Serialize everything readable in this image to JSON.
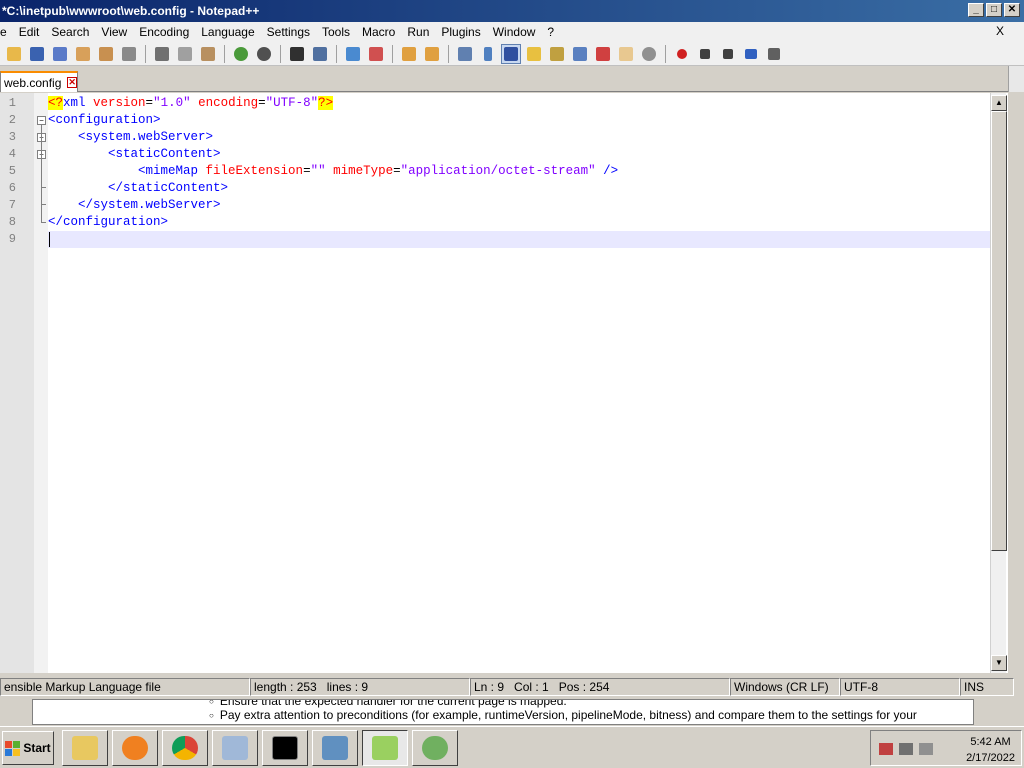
{
  "window": {
    "title": "*C:\\inetpub\\wwwroot\\web.config - Notepad++",
    "minimize": "_",
    "maximize": "□",
    "close": "✕"
  },
  "menu": {
    "items": [
      "e",
      "Edit",
      "Search",
      "View",
      "Encoding",
      "Language",
      "Settings",
      "Tools",
      "Macro",
      "Run",
      "Plugins",
      "Window",
      "?"
    ],
    "close_doc": "X"
  },
  "toolbar": {
    "icons": [
      "open-icon",
      "save-icon",
      "save-all-icon",
      "close-icon",
      "close-all-icon",
      "print-icon",
      "cut-icon",
      "copy-icon",
      "paste-icon",
      "undo-icon",
      "redo-icon",
      "find-icon",
      "replace-icon",
      "zoom-in-icon",
      "zoom-out-icon",
      "sync-v-icon",
      "sync-h-icon",
      "word-wrap-icon",
      "show-all-chars-icon",
      "indent-guide-icon",
      "udl-icon",
      "doc-map-icon",
      "function-list-icon",
      "folder-workspace-icon",
      "monitoring-icon",
      "record-macro-icon",
      "stop-macro-icon",
      "play-macro-icon",
      "run-macro-multiple-icon",
      "save-macro-icon"
    ]
  },
  "tab": {
    "label": "web.config",
    "close": "✕"
  },
  "editor": {
    "line_numbers": [
      "1",
      "2",
      "3",
      "4",
      "5",
      "6",
      "7",
      "8",
      "9"
    ],
    "lines": {
      "l1": {
        "decl_open": "<?",
        "tag": "xml",
        "attr1": " version",
        "eq1": "=",
        "val1": "\"1.0\"",
        "attr2": " encoding",
        "eq2": "=",
        "val2": "\"UTF-8\"",
        "decl_close": "?>"
      },
      "l2": {
        "tag": "<configuration>"
      },
      "l3": {
        "tag": "<system.webServer>"
      },
      "l4": {
        "tag": "<staticContent>"
      },
      "l5": {
        "open": "<mimeMap",
        "attr1": " fileExtension",
        "eq1": "=",
        "val1": "\"\"",
        "attr2": " mimeType",
        "eq2": "=",
        "val2": "\"application/octet-stream\"",
        "close": " />"
      },
      "l6": {
        "tag": "</staticContent>"
      },
      "l7": {
        "tag": "</system.webServer>"
      },
      "l8": {
        "tag": "</configuration>"
      }
    }
  },
  "status": {
    "file_type": "ensible Markup Language file",
    "length": "length : 253",
    "lines": "lines : 9",
    "ln": "Ln : 9",
    "col": "Col : 1",
    "pos": "Pos : 254",
    "eol": "Windows (CR LF)",
    "encoding": "UTF-8",
    "mode": "INS"
  },
  "background_page": {
    "line1": "Ensure that the expected handler for the current page is mapped.",
    "line2": "Pay extra attention to preconditions (for example, runtimeVersion, pipelineMode, bitness) and compare them to the settings for your"
  },
  "taskbar": {
    "start": "Start",
    "apps": [
      "file-explorer-icon",
      "media-player-icon",
      "chrome-icon",
      "configuration-icon",
      "command-prompt-icon",
      "iis-manager-icon",
      "notepad-plus-plus-icon",
      "network-tool-icon"
    ],
    "clock_time": "5:42 AM",
    "clock_date": "2/17/2022"
  },
  "colors": {
    "tag": "#0000ff",
    "attribute": "#ff0000",
    "value": "#8000ff",
    "xml_decl_bg": "#ffff00",
    "current_line": "#e8e8ff",
    "title_bar": "#0a246a"
  }
}
